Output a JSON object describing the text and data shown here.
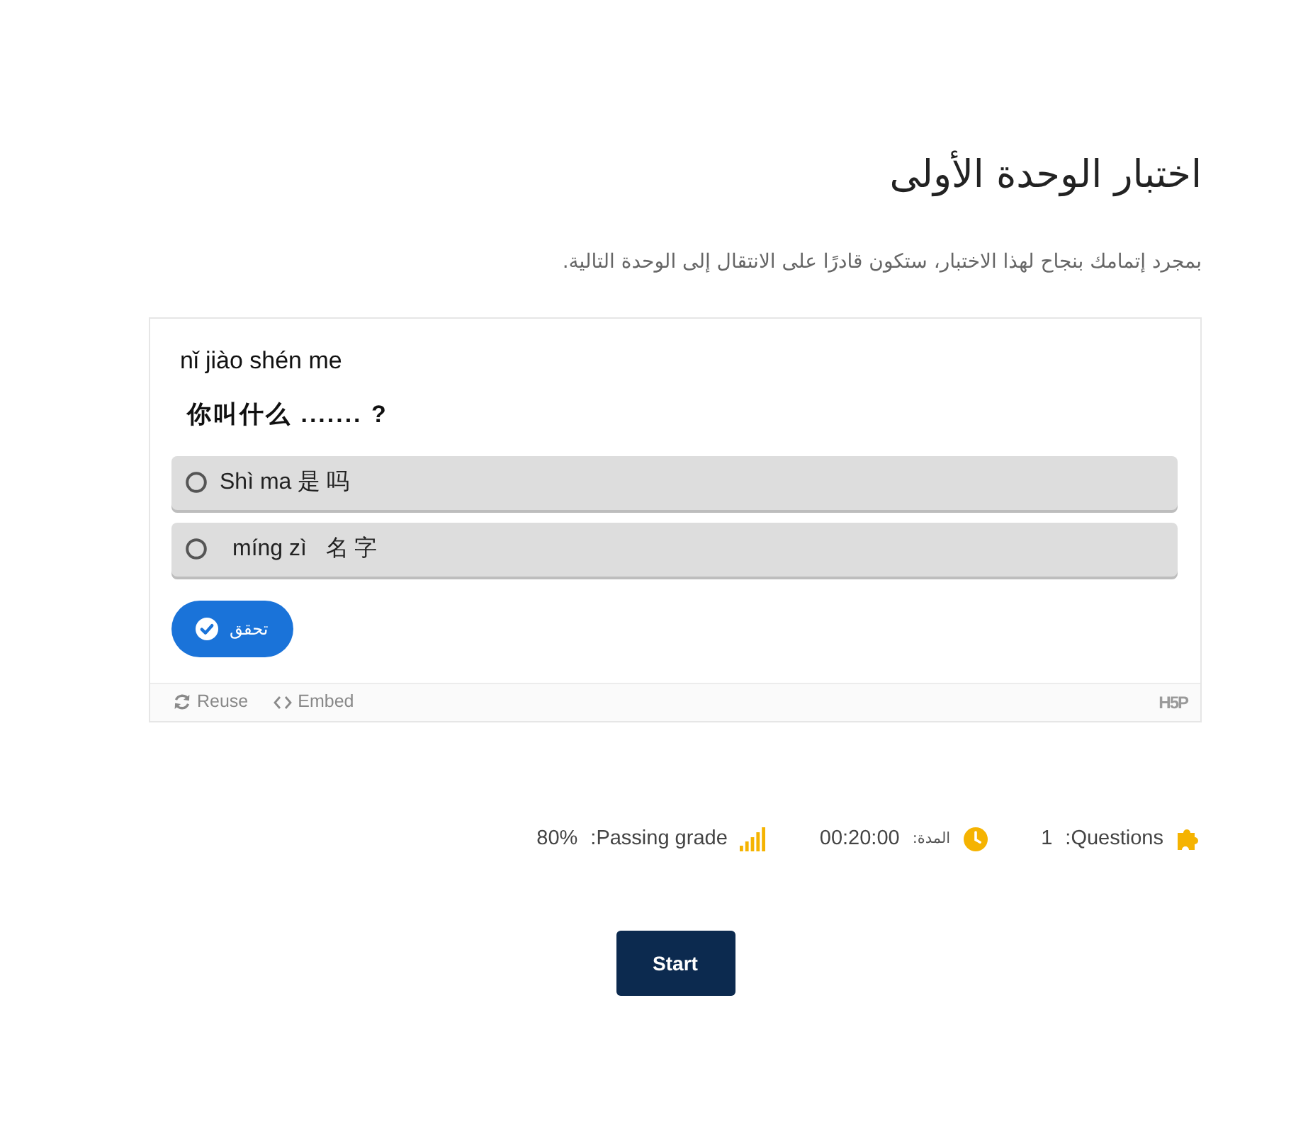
{
  "quiz": {
    "title": "اختبار الوحدة الأولى",
    "description": "بمجرد إتمامك بنجاح لهذا الاختبار، ستكون قادرًا على الانتقال إلى الوحدة التالية."
  },
  "question": {
    "pinyin": "nǐ jiào shén me",
    "text": "你叫什么 ....... ?",
    "options": [
      {
        "label": "Shì ma 是 吗",
        "selected": false
      },
      {
        "label": "míng zì   名 字",
        "selected": false
      }
    ],
    "check_button": "تحقق",
    "footer": {
      "actions": [
        {
          "kind": "reuse",
          "label": "Reuse"
        },
        {
          "kind": "embed",
          "label": "Embed"
        }
      ],
      "logo": "H5P"
    }
  },
  "info": [
    {
      "kind": "passing",
      "label": "Passing grade:",
      "value": "80%"
    },
    {
      "kind": "duration",
      "label": "المدة:",
      "value": "00:20:00"
    },
    {
      "kind": "questions",
      "label": "Questions:",
      "value": "1"
    }
  ],
  "start_button": "Start"
}
